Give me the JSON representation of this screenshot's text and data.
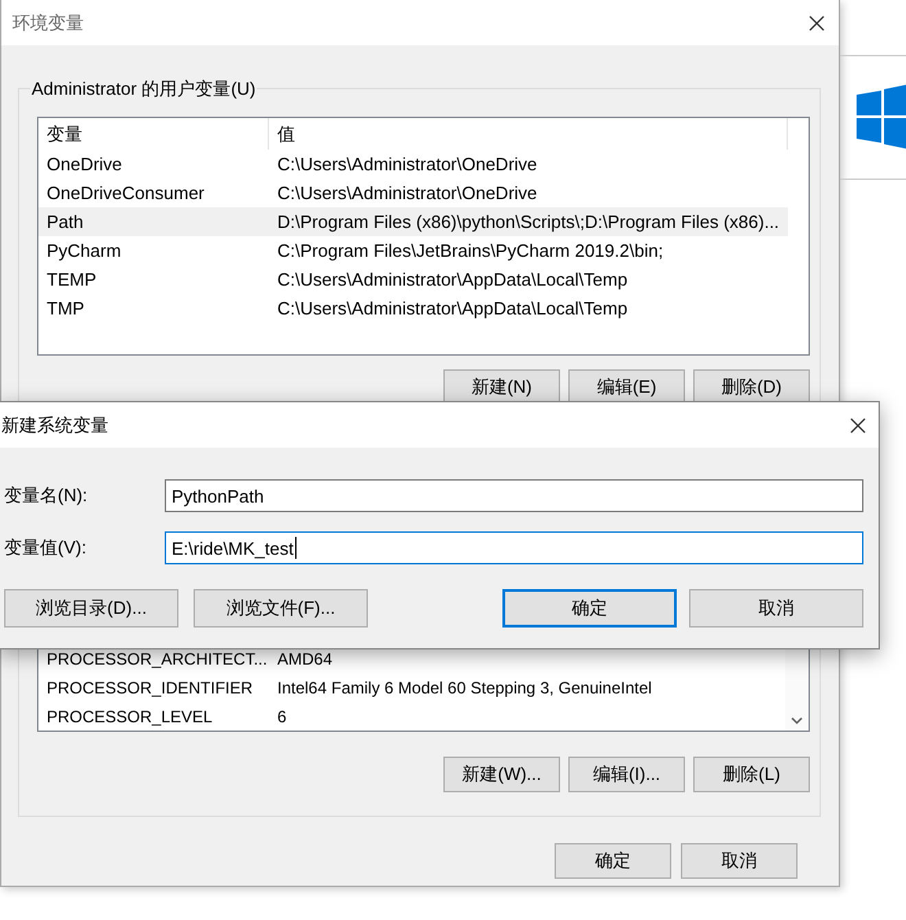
{
  "window": {
    "title": "环境变量"
  },
  "user_variables": {
    "label": "Administrator 的用户变量(U)",
    "columns": [
      "变量",
      "值"
    ],
    "rows": [
      {
        "name": "OneDrive",
        "value": "C:\\Users\\Administrator\\OneDrive",
        "selected": false
      },
      {
        "name": "OneDriveConsumer",
        "value": "C:\\Users\\Administrator\\OneDrive",
        "selected": false
      },
      {
        "name": "Path",
        "value": "D:\\Program Files (x86)\\python\\Scripts\\;D:\\Program Files (x86)...",
        "selected": true
      },
      {
        "name": "PyCharm",
        "value": "C:\\Program Files\\JetBrains\\PyCharm 2019.2\\bin;",
        "selected": false
      },
      {
        "name": "TEMP",
        "value": "C:\\Users\\Administrator\\AppData\\Local\\Temp",
        "selected": false
      },
      {
        "name": "TMP",
        "value": "C:\\Users\\Administrator\\AppData\\Local\\Temp",
        "selected": false
      }
    ],
    "buttons": [
      "新建(N)",
      "编辑(E)",
      "删除(D)"
    ]
  },
  "system_variables": {
    "rows": [
      {
        "name": "PROCESSOR_ARCHITECT...",
        "value": "AMD64"
      },
      {
        "name": "PROCESSOR_IDENTIFIER",
        "value": "Intel64 Family 6 Model 60 Stepping 3, GenuineIntel"
      },
      {
        "name": "PROCESSOR_LEVEL",
        "value": "6"
      }
    ],
    "buttons": [
      "新建(W)...",
      "编辑(I)...",
      "删除(L)"
    ]
  },
  "buttons": [
    "确定",
    "取消"
  ],
  "dialog": {
    "title": "新建系统变量",
    "fields": [
      {
        "label": "变量名(N):",
        "value": "PythonPath",
        "focused": false
      },
      {
        "label": "变量值(V):",
        "value": "E:\\ride\\MK_test",
        "focused": true
      }
    ],
    "browse_buttons": [
      "浏览目录(D)...",
      "浏览文件(F)..."
    ],
    "buttons": [
      {
        "label": "确定",
        "default": true
      },
      {
        "label": "取消",
        "default": false
      }
    ]
  }
}
